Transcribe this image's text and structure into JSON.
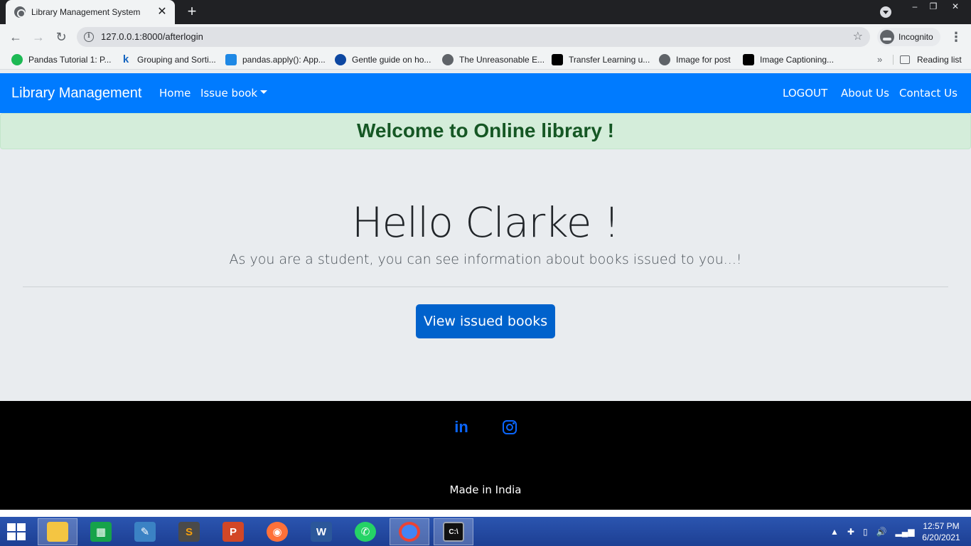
{
  "browser": {
    "tab_title": "Library Management System",
    "tab_close": "✕",
    "new_tab": "+",
    "url": "127.0.0.1:8000/afterlogin",
    "profile_label": "Incognito",
    "window_controls": {
      "minimize": "–",
      "maximize": "❐",
      "close": "✕"
    },
    "bookmarks": [
      {
        "label": "Pandas Tutorial 1: P...",
        "icon": "pandas-icon",
        "color": "#1db954"
      },
      {
        "label": "Grouping and Sorti...",
        "icon": "k-icon",
        "color": "#1565c0"
      },
      {
        "label": "pandas.apply(): App...",
        "icon": "pandas-apply-icon",
        "color": "#1e88e5"
      },
      {
        "label": "Gentle guide on ho...",
        "icon": "gentle-guide-icon",
        "color": "#0d47a1"
      },
      {
        "label": "The Unreasonable E...",
        "icon": "globe-icon",
        "color": "#5f6368"
      },
      {
        "label": "Transfer Learning u...",
        "icon": "medium-icon",
        "color": "#000000"
      },
      {
        "label": "Image for post",
        "icon": "globe-icon",
        "color": "#5f6368"
      },
      {
        "label": "Image Captioning...",
        "icon": "medium-icon",
        "color": "#000000"
      }
    ],
    "bookmarks_overflow": "»",
    "reading_list": "Reading list"
  },
  "navbar": {
    "brand": "Library Management",
    "links": {
      "home": "Home",
      "issue": "Issue book",
      "logout": "LOGOUT",
      "about": "About Us",
      "contact": "Contact Us"
    },
    "background": "#007bff"
  },
  "alert": {
    "text": "Welcome to Online library !",
    "color": "#155724"
  },
  "jumbotron": {
    "greeting": "Hello Clarke !",
    "lead": "As you are a student, you can see information about books issued to you...!",
    "button": "View issued books"
  },
  "footer": {
    "made_in": "Made in India",
    "social": [
      "linkedin-icon",
      "instagram-icon"
    ],
    "linkedin_glyph": "in"
  },
  "taskbar": {
    "apps": [
      "file-explorer-icon",
      "store-icon",
      "gallery-icon",
      "sublime-text-icon",
      "powerpoint-icon",
      "firefox-icon",
      "word-icon",
      "whatsapp-icon",
      "chrome-icon",
      "terminal-icon"
    ],
    "time": "12:57 PM",
    "date": "6/20/2021"
  }
}
